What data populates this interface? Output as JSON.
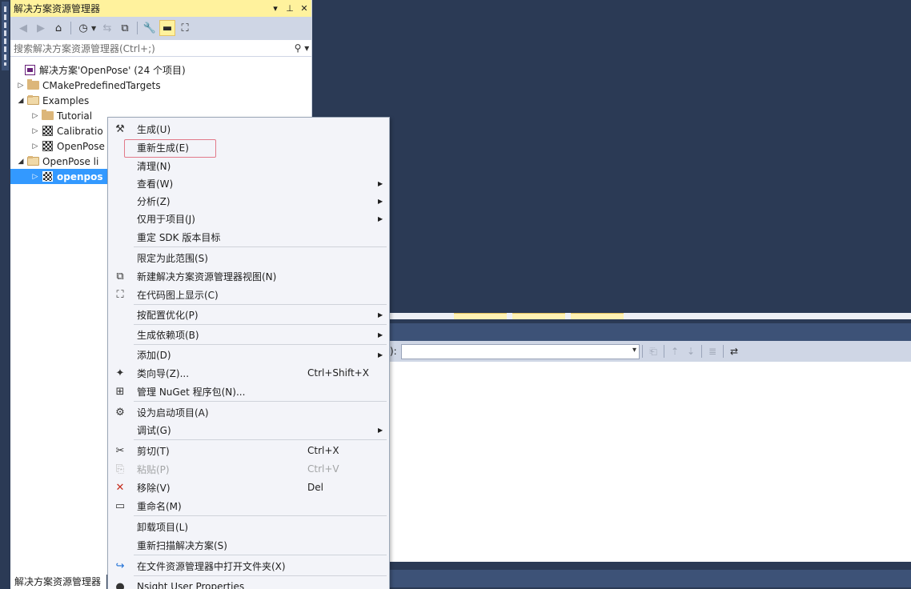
{
  "solution_explorer": {
    "title": "解决方案资源管理器",
    "title_buttons": [
      "▾",
      "⊥",
      "✕"
    ],
    "search_placeholder": "搜索解决方案资源管理器(Ctrl+;)",
    "bottom_tab": "解决方案资源管理器",
    "tree": [
      {
        "label": "解决方案'OpenPose' (24 个项目)",
        "icon": "solution-icon",
        "arrow": "",
        "indent": 0
      },
      {
        "label": "CMakePredefinedTargets",
        "icon": "folder-icon",
        "arrow": "▷",
        "indent": 0
      },
      {
        "label": "Examples",
        "icon": "folder-open-icon",
        "arrow": "◢",
        "indent": 0
      },
      {
        "label": "Tutorial",
        "icon": "folder-icon",
        "arrow": "▷",
        "indent": 1
      },
      {
        "label": "Calibratio",
        "icon": "project-icon",
        "arrow": "▷",
        "indent": 1
      },
      {
        "label": "OpenPose",
        "icon": "project-icon",
        "arrow": "▷",
        "indent": 1
      },
      {
        "label": "OpenPose li",
        "icon": "folder-open-icon",
        "arrow": "◢",
        "indent": 0
      },
      {
        "label": "openpos",
        "icon": "project-icon",
        "arrow": "▷",
        "indent": 1,
        "selected": true
      }
    ]
  },
  "context_menu": {
    "items": [
      {
        "label": "生成(U)",
        "icon": "build-icon",
        "glyph": "⚒",
        "shortcut": "",
        "submenu": false
      },
      {
        "label": "重新生成(E)",
        "icon": "",
        "glyph": "",
        "shortcut": "",
        "submenu": false
      },
      {
        "label": "清理(N)",
        "icon": "",
        "glyph": "",
        "shortcut": "",
        "submenu": false
      },
      {
        "label": "查看(W)",
        "icon": "",
        "glyph": "",
        "shortcut": "",
        "submenu": true
      },
      {
        "label": "分析(Z)",
        "icon": "",
        "glyph": "",
        "shortcut": "",
        "submenu": true
      },
      {
        "label": "仅用于项目(J)",
        "icon": "",
        "glyph": "",
        "shortcut": "",
        "submenu": true
      },
      {
        "label": "重定 SDK 版本目标",
        "icon": "",
        "glyph": "",
        "shortcut": "",
        "submenu": false
      },
      {
        "label": "限定为此范围(S)",
        "icon": "",
        "glyph": "",
        "shortcut": "",
        "submenu": false
      },
      {
        "label": "新建解决方案资源管理器视图(N)",
        "icon": "new-view-icon",
        "glyph": "⧉",
        "shortcut": "",
        "submenu": false
      },
      {
        "label": "在代码图上显示(C)",
        "icon": "code-map-icon",
        "glyph": "⛶",
        "shortcut": "",
        "submenu": false
      },
      {
        "label": "按配置优化(P)",
        "icon": "",
        "glyph": "",
        "shortcut": "",
        "submenu": true
      },
      {
        "label": "生成依赖项(B)",
        "icon": "",
        "glyph": "",
        "shortcut": "",
        "submenu": true
      },
      {
        "label": "添加(D)",
        "icon": "",
        "glyph": "",
        "shortcut": "",
        "submenu": true
      },
      {
        "label": "类向导(Z)...",
        "icon": "class-wizard-icon",
        "glyph": "✦",
        "shortcut": "Ctrl+Shift+X",
        "submenu": false
      },
      {
        "label": "管理 NuGet 程序包(N)...",
        "icon": "nuget-icon",
        "glyph": "⊞",
        "shortcut": "",
        "submenu": false
      },
      {
        "label": "设为启动项目(A)",
        "icon": "gear-icon",
        "glyph": "⚙",
        "shortcut": "",
        "submenu": false
      },
      {
        "label": "调试(G)",
        "icon": "",
        "glyph": "",
        "shortcut": "",
        "submenu": true
      },
      {
        "label": "剪切(T)",
        "icon": "scissors-icon",
        "glyph": "✂",
        "shortcut": "Ctrl+X",
        "submenu": false
      },
      {
        "label": "粘贴(P)",
        "icon": "paste-icon",
        "glyph": "⎘",
        "shortcut": "Ctrl+V",
        "submenu": false,
        "disabled": true
      },
      {
        "label": "移除(V)",
        "icon": "remove-icon",
        "glyph": "✕",
        "shortcut": "Del",
        "submenu": false
      },
      {
        "label": "重命名(M)",
        "icon": "rename-icon",
        "glyph": "▭",
        "shortcut": "",
        "submenu": false
      },
      {
        "label": "卸载项目(L)",
        "icon": "",
        "glyph": "",
        "shortcut": "",
        "submenu": false
      },
      {
        "label": "重新扫描解决方案(S)",
        "icon": "",
        "glyph": "",
        "shortcut": "",
        "submenu": false
      },
      {
        "label": "在文件资源管理器中打开文件夹(X)",
        "icon": "open-folder-icon",
        "glyph": "↪",
        "shortcut": "",
        "submenu": false
      },
      {
        "label": "Nsight User Properties",
        "icon": "nsight-icon",
        "glyph": "●",
        "shortcut": "",
        "submenu": false
      }
    ]
  },
  "output_panel": {
    "toolbar_label": "):"
  },
  "colors": {
    "background": "#2b3a55",
    "title_active": "#fff29d",
    "selection": "#3399ff",
    "highlight_box": "#e27a8a"
  }
}
